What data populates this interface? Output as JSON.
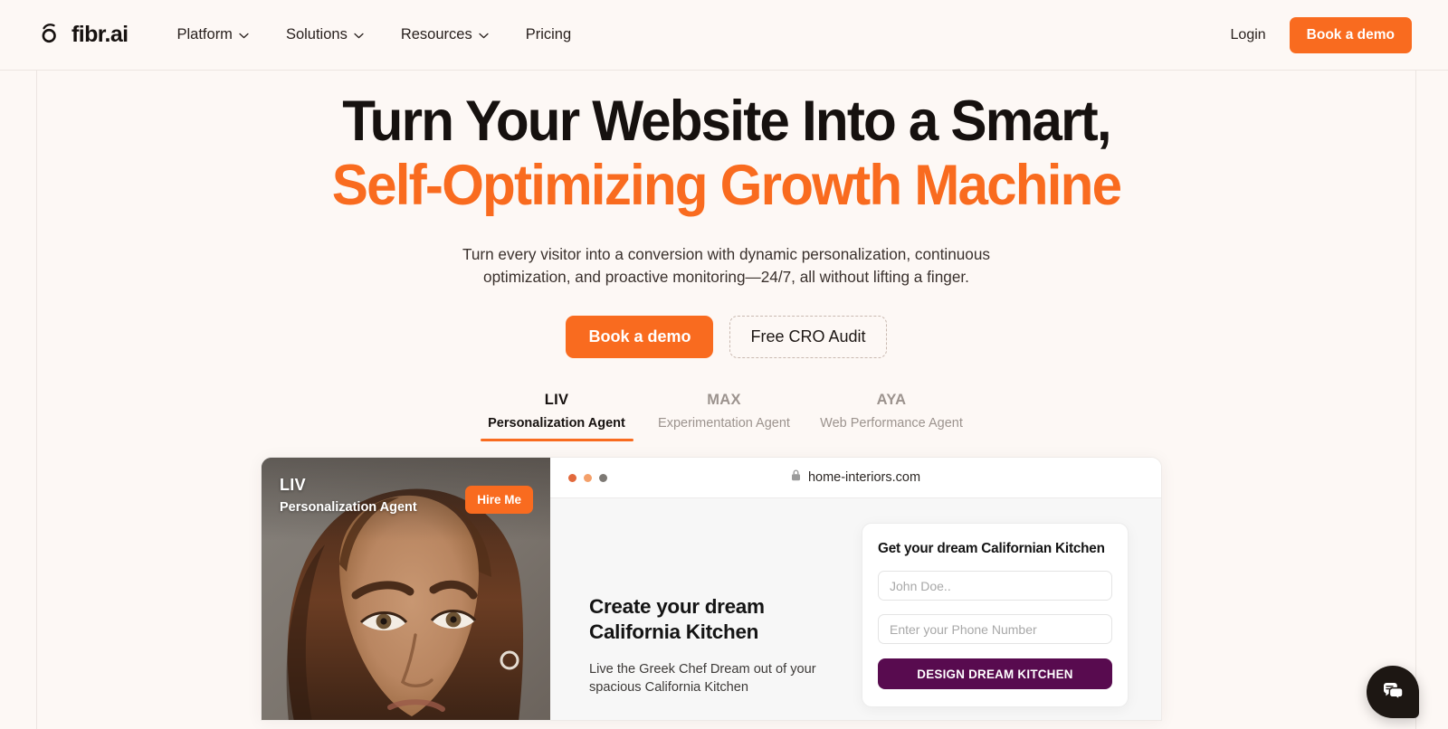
{
  "brand": {
    "name": "fibr.ai",
    "logo_icon": "eye-circle-icon"
  },
  "nav": {
    "items": [
      {
        "label": "Platform",
        "has_dropdown": true
      },
      {
        "label": "Solutions",
        "has_dropdown": true
      },
      {
        "label": "Resources",
        "has_dropdown": true
      },
      {
        "label": "Pricing",
        "has_dropdown": false
      }
    ],
    "login_label": "Login",
    "demo_label": "Book a demo"
  },
  "hero": {
    "headline_line1": "Turn Your Website Into a Smart,",
    "headline_line2": "Self-Optimizing Growth Machine",
    "subhead_line1": "Turn every visitor into a conversion with dynamic personalization, continuous",
    "subhead_line2": "optimization, and proactive monitoring—24/7, all without lifting a finger.",
    "primary_cta": "Book a demo",
    "secondary_cta": "Free CRO Audit"
  },
  "tabs": [
    {
      "code": "LIV",
      "name": "Personalization Agent",
      "active": true
    },
    {
      "code": "MAX",
      "name": "Experimentation Agent",
      "active": false
    },
    {
      "code": "AYA",
      "name": "Web Performance Agent",
      "active": false
    }
  ],
  "agent_card": {
    "code": "LIV",
    "role": "Personalization Agent",
    "hire_label": "Hire Me"
  },
  "browser": {
    "url": "home-interiors.com",
    "lock_icon": "lock-icon",
    "dots": [
      "red",
      "yellow",
      "green"
    ]
  },
  "demo_site": {
    "heading_line1": "Create your dream",
    "heading_line2": "California Kitchen",
    "paragraph_line1": "Live the Greek Chef Dream out of your",
    "paragraph_line2": "spacious California Kitchen",
    "form": {
      "title": "Get your dream Californian Kitchen",
      "name_placeholder": "John Doe..",
      "name_value": "",
      "phone_placeholder": "Enter your Phone Number",
      "phone_value": "",
      "submit_label": "DESIGN DREAM KITCHEN"
    }
  },
  "chat": {
    "icon": "chat-bubble-icon"
  },
  "colors": {
    "accent_orange": "#f96b1f",
    "page_bg": "#fdf8f5",
    "text_dark": "#16110f",
    "muted": "#9c938e",
    "purple_cta": "#580b4f",
    "chat_dark": "#1d1713"
  }
}
